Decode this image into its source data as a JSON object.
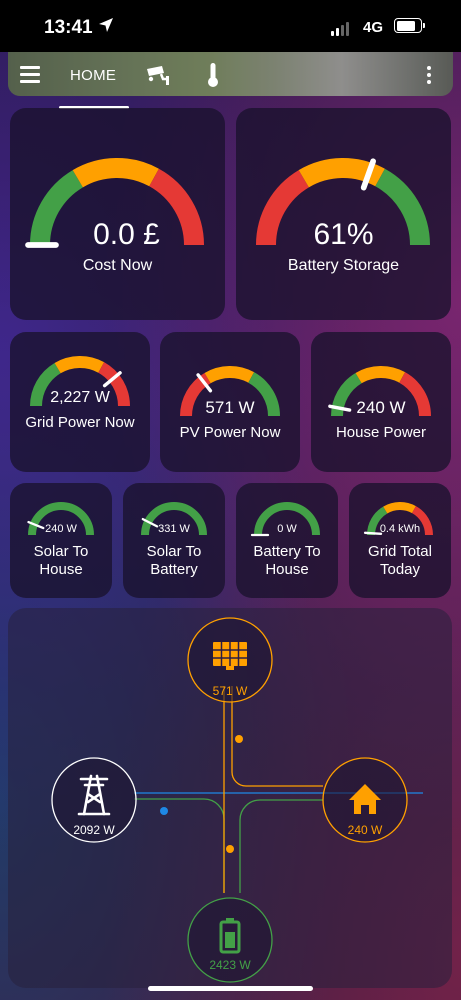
{
  "status_bar": {
    "time": "13:41",
    "network": "4G"
  },
  "nav": {
    "home_tab": "HOME"
  },
  "colors": {
    "green": "#43a047",
    "orange": "#ffa000",
    "red": "#e53935",
    "grid_white": "#ffffff",
    "blue": "#1e88e5"
  },
  "gauges_large": [
    {
      "value": "0.0 £",
      "label": "Cost Now",
      "needle_fraction": 0.0,
      "scheme": "green-orange-red"
    },
    {
      "value": "61%",
      "label": "Battery Storage",
      "needle_fraction": 0.61,
      "scheme": "red-orange-green"
    }
  ],
  "gauges_medium": [
    {
      "value": "2,227 W",
      "label": "Grid Power Now",
      "needle_fraction": 0.78,
      "scheme": "green-orange-red"
    },
    {
      "value": "571 W",
      "label": "PV Power Now",
      "needle_fraction": 0.29,
      "scheme": "red-orange-green"
    },
    {
      "value": "240 W",
      "label": "House Power",
      "needle_fraction": 0.06,
      "scheme": "green-orange-red"
    }
  ],
  "gauges_small": [
    {
      "value": "240 W",
      "label": "Solar To House",
      "needle_fraction": 0.12,
      "scheme": "green"
    },
    {
      "value": "331 W",
      "label": "Solar To Battery",
      "needle_fraction": 0.15,
      "scheme": "green"
    },
    {
      "value": "0 W",
      "label": "Battery To House",
      "needle_fraction": 0.0,
      "scheme": "green"
    },
    {
      "value": "0.4 kWh",
      "label": "Grid Total Today",
      "needle_fraction": 0.02,
      "scheme": "green-orange-red"
    }
  ],
  "power_flow": {
    "solar": {
      "value": "571 W",
      "icon": "solar-panel-icon",
      "color": "#ffa000"
    },
    "grid": {
      "value": "2092 W",
      "icon": "transmission-tower-icon",
      "color": "#ffffff"
    },
    "home": {
      "value": "240 W",
      "icon": "home-icon",
      "color": "#ffa000"
    },
    "battery": {
      "value": "2423 W",
      "icon": "battery-icon",
      "color": "#43a047"
    }
  }
}
